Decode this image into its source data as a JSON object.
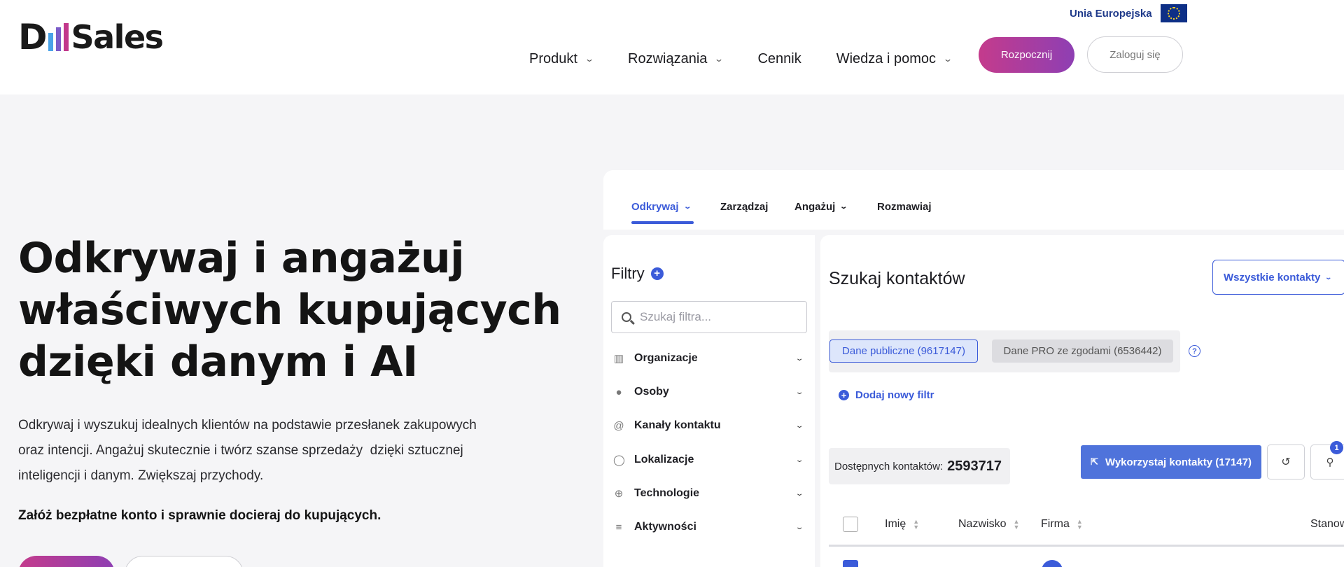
{
  "header": {
    "logo": {
      "prefix": "D",
      "suffix": "Sales",
      "bar_colors": [
        "#4aa3e8",
        "#7b5cc9",
        "#c2378b"
      ]
    },
    "eu_label": "Unia Europejska",
    "nav": [
      {
        "label": "Produkt",
        "has_dropdown": true
      },
      {
        "label": "Rozwiązania",
        "has_dropdown": true
      },
      {
        "label": "Cennik",
        "has_dropdown": false
      },
      {
        "label": "Wiedza i pomoc",
        "has_dropdown": true
      }
    ],
    "start_label": "Rozpocznij",
    "login_label": "Zaloguj się"
  },
  "hero": {
    "title_lines": [
      "Odkrywaj i angażuj",
      "właściwych kupujących",
      "dzięki danym i AI"
    ],
    "desc_lines": [
      "Odkrywaj i wyszukuj idealnych klientów na podstawie przesłanek zakupowych",
      "oraz intencji. Angażuj skutecznie i twórz szanse sprzedaży  dzięki sztucznej",
      "inteligencji i danym. Zwiększaj przychody."
    ],
    "cta": "Załóż bezpłatne konto i sprawnie docieraj do kupujących."
  },
  "app": {
    "tabs": [
      {
        "label": "Odkrywaj",
        "active": true,
        "has_dropdown": true
      },
      {
        "label": "Zarządzaj",
        "active": false,
        "has_dropdown": false
      },
      {
        "label": "Angażuj",
        "active": false,
        "has_dropdown": true
      },
      {
        "label": "Rozmawiaj",
        "active": false,
        "has_dropdown": false
      }
    ],
    "filters": {
      "title": "Filtry",
      "search_placeholder": "Szukaj filtra...",
      "items": [
        {
          "label": "Organizacje",
          "icon": "building-icon"
        },
        {
          "label": "Osoby",
          "icon": "person-icon"
        },
        {
          "label": "Kanały kontaktu",
          "icon": "at-icon"
        },
        {
          "label": "Lokalizacje",
          "icon": "location-icon"
        },
        {
          "label": "Technologie",
          "icon": "globe-icon"
        },
        {
          "label": "Aktywności",
          "icon": "database-icon"
        }
      ]
    },
    "main": {
      "title": "Szukaj kontaktów",
      "all_contacts_label": "Wszystkie kontakty",
      "segment_public": "Dane publiczne (9617147)",
      "segment_pro": "Dane PRO ze zgodami (6536442)",
      "help": "?",
      "add_filter": "Dodaj nowy filtr",
      "available_label": "Dostępnych kontaktów:",
      "available_value": "2593717",
      "use_contacts_label": "Wykorzystaj kontakty (17147)",
      "notification_count": "1",
      "columns": [
        "Imię",
        "Nazwisko",
        "Firma",
        "Stanow"
      ]
    }
  },
  "colors": {
    "accent": "#3b5bd9",
    "cta_gradient_start": "#c43b8c",
    "cta_gradient_end": "#8e3fb3",
    "eu_blue": "#0d2f86"
  }
}
